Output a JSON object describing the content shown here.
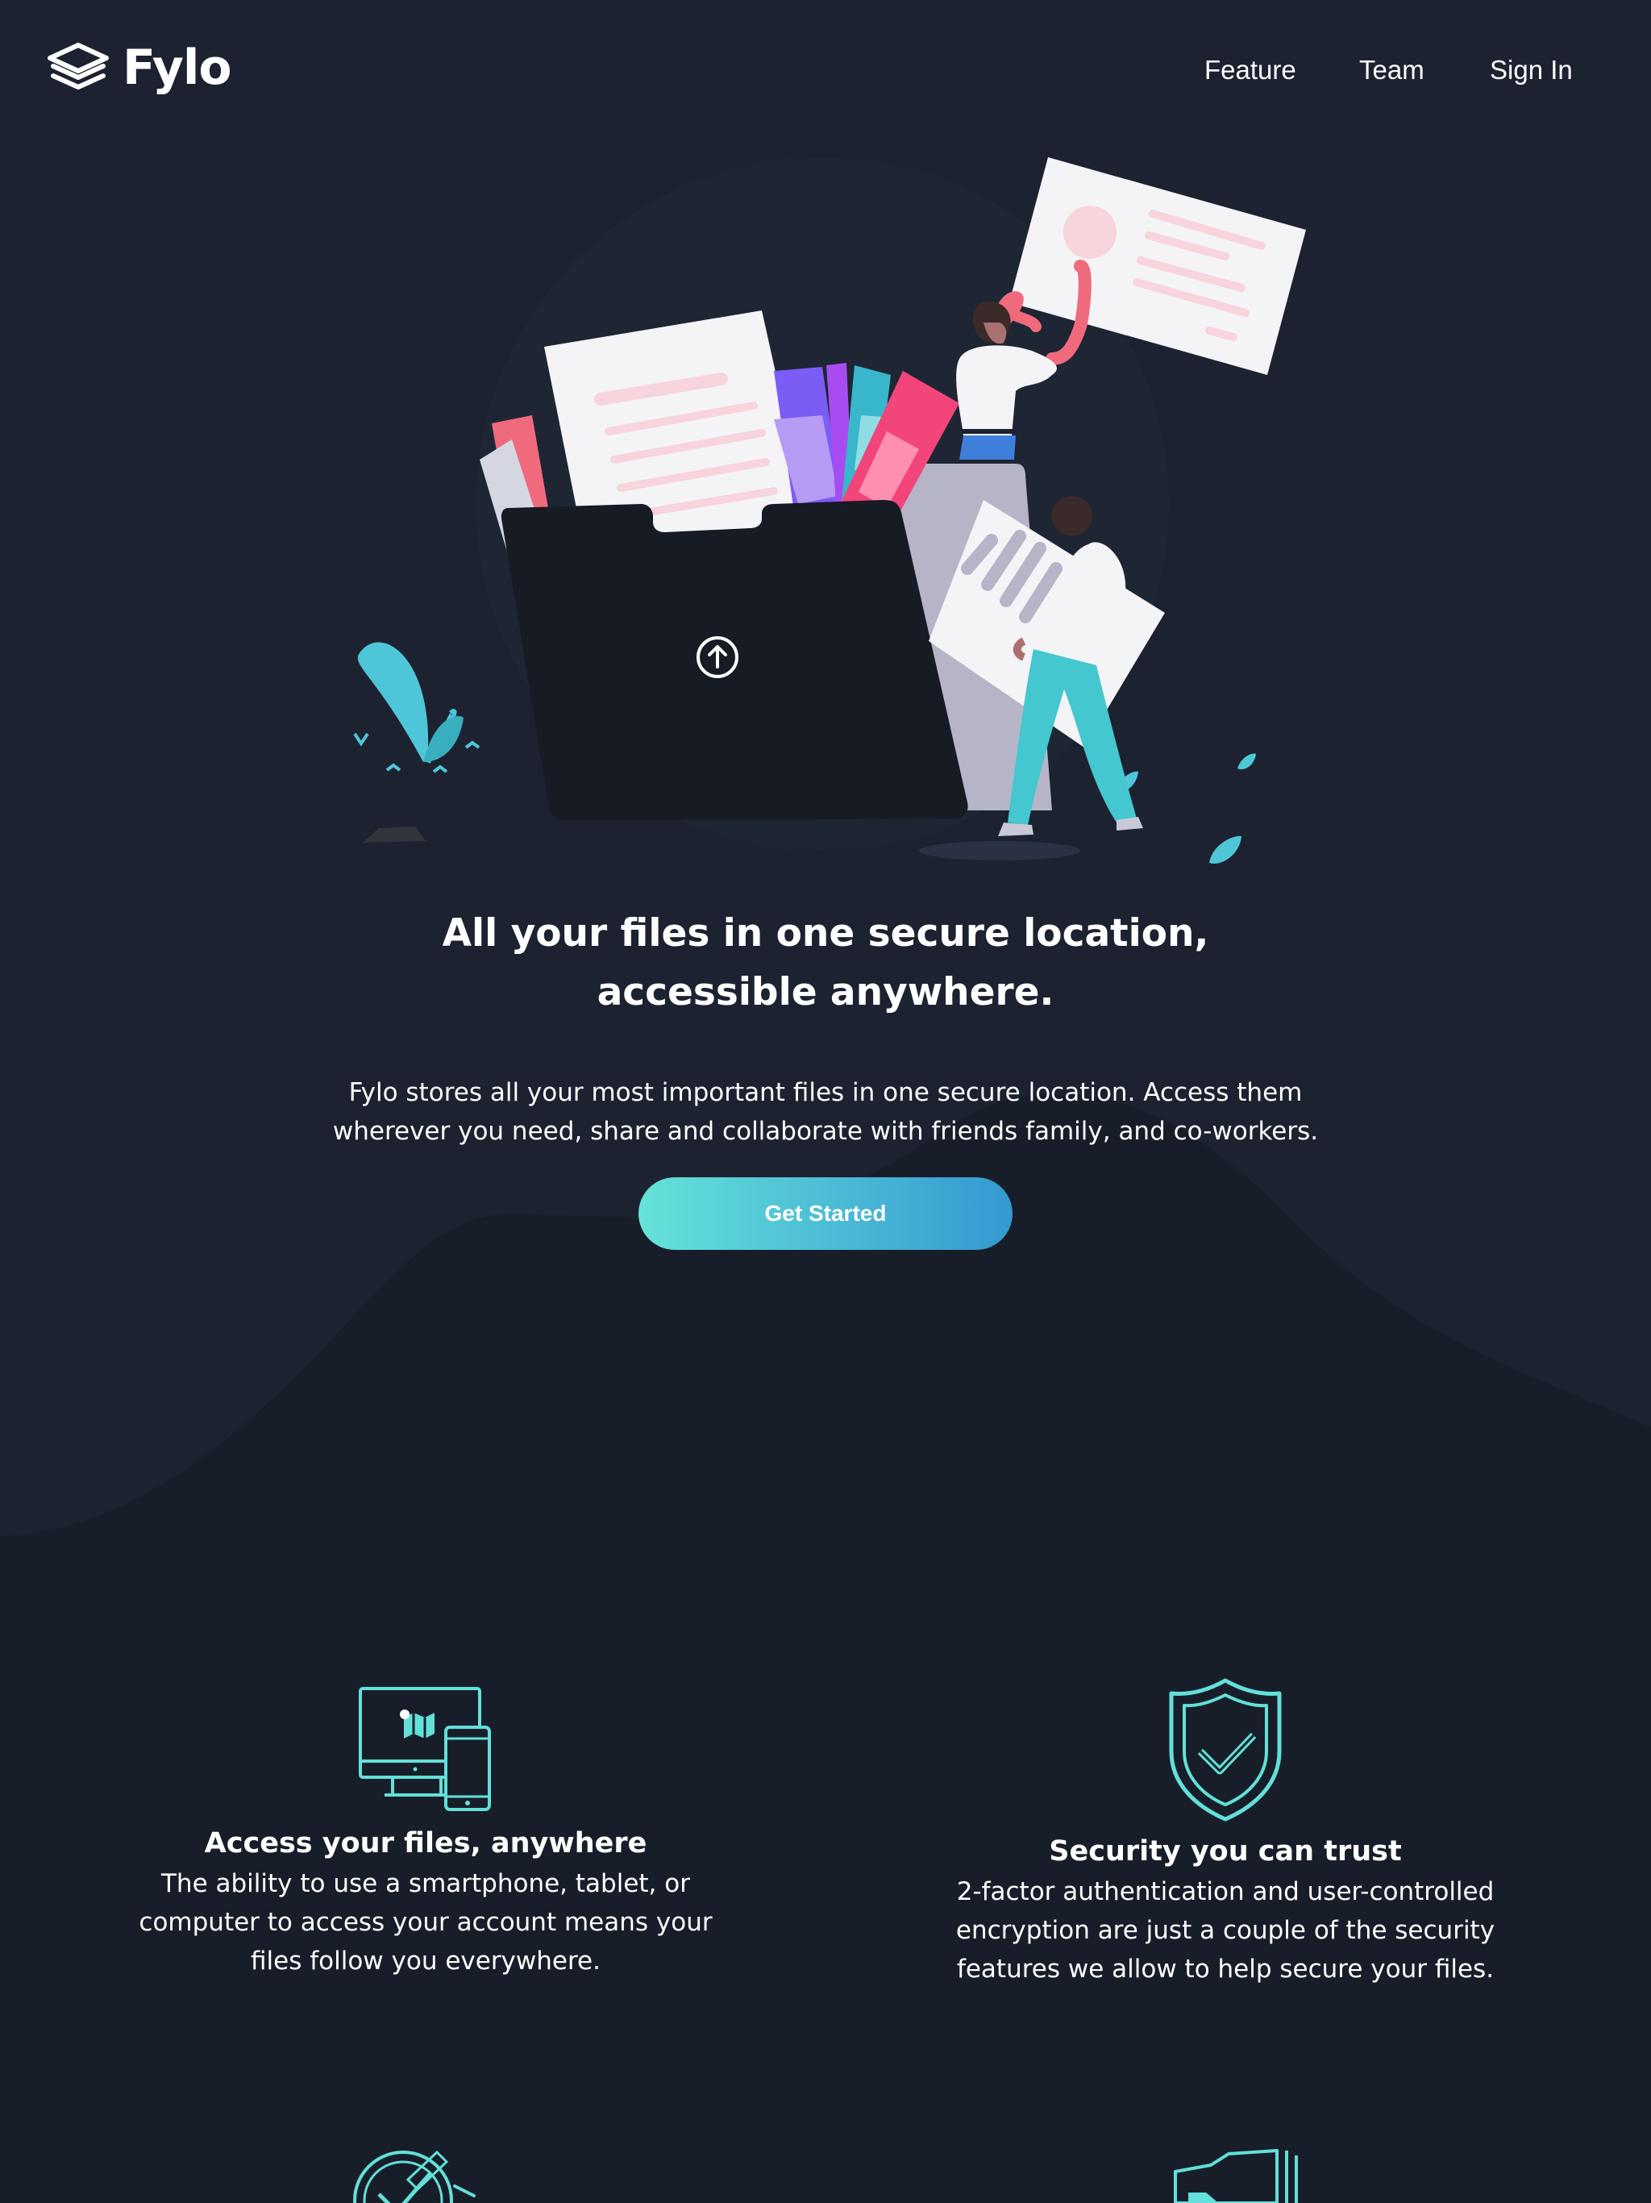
{
  "brand": {
    "name": "Fylo"
  },
  "nav": {
    "items": [
      "Feature",
      "Team",
      "Sign In"
    ]
  },
  "hero": {
    "title": "All your files in one secure location, accessible anywhere.",
    "text": "Fylo stores all your most important files in one secure location. Access them wherever you need, share and collaborate with friends family, and co-workers.",
    "cta_label": "Get Started"
  },
  "features": [
    {
      "icon": "devices-icon",
      "title": "Access your files, anywhere",
      "text": "The ability to use a smartphone, tablet, or computer to access your account means your files follow you everywhere."
    },
    {
      "icon": "shield-check-icon",
      "title": "Security you can trust",
      "text": "2-factor authentication and user-controlled encryption are just a couple of the security features we allow to help secure your files."
    },
    {
      "icon": "collaboration-icon"
    },
    {
      "icon": "folder-file-icon"
    }
  ],
  "colors": {
    "background_dark": "#181e29",
    "background_hero": "#1c2230",
    "accent_cyan": "#65e2d9",
    "accent_blue": "#3399d2",
    "icon_stroke": "#62e0d9"
  }
}
